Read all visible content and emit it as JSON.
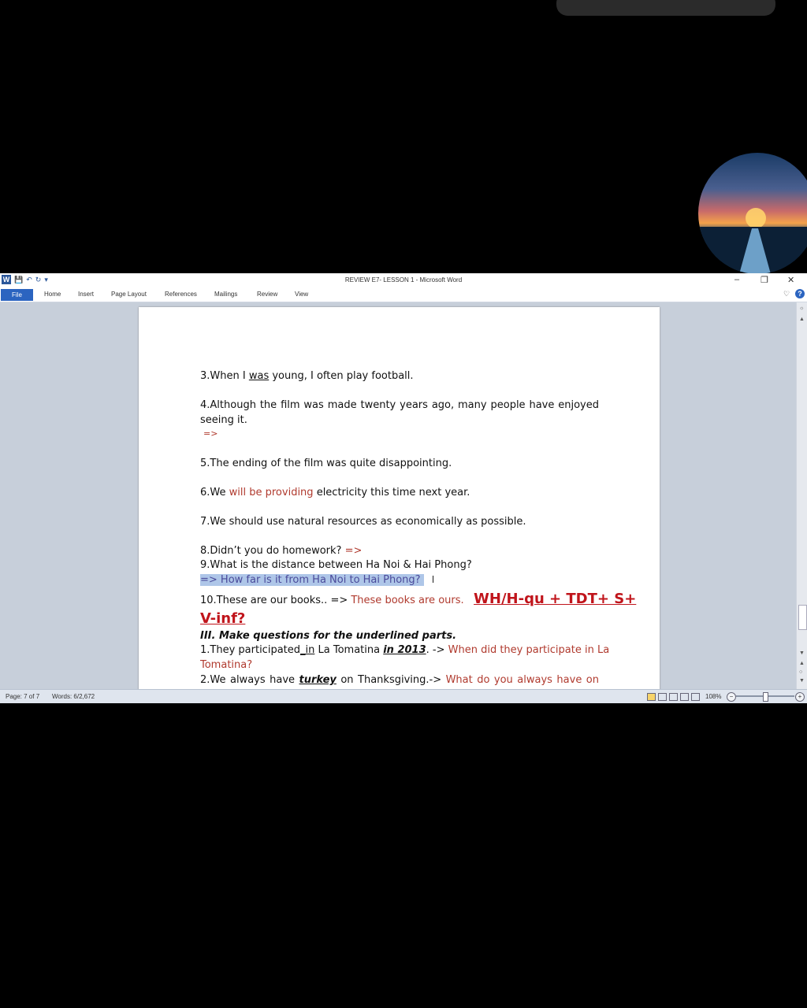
{
  "window": {
    "title": "REVIEW E7- LESSON 1  -  Microsoft Word",
    "app_icon": "W"
  },
  "ribbon": {
    "file": "File",
    "tabs": [
      "Home",
      "Insert",
      "Page Layout",
      "References",
      "Mailings",
      "Review",
      "View"
    ]
  },
  "document": {
    "l3_pre": "3.When I ",
    "l3_u": "was",
    "l3_post": " young, I often play football.",
    "l4a": "4.Although the film was made twenty years ago, many people have enjoyed",
    "l4b": "seeing it.",
    "l4c": "=>",
    "l5": "5.The ending of the film was quite disappointing.",
    "l6_pre": "6.We ",
    "l6_red": "will be providing",
    "l6_post": " electricity this time next year.",
    "l7": "7.We should use natural resources as economically as possible.",
    "l8_pre": "8.Didn’t you do homework? ",
    "l8_red": "=>",
    "l9": "9.What is the distance between Ha Noi & Hai Phong?",
    "l9_ans": "=> How far  is it from Ha Noi to Hai Phong? ",
    "l10_pre": "10.These are our books.. => ",
    "l10_red": "These books  are ours.",
    "formula_a": "WH/H-qu + TDT+ S+",
    "formula_b": "V-inf?",
    "section": "III. Make questions for the underlined parts.",
    "q1_pre": "1.They participated",
    "q1_u": "_in",
    "q1_mid": " La Tomatina ",
    "q1_bold": "in 2013",
    "q1_post": ". -> ",
    "q1_red": "When did they participate in La",
    "q1_red2": "Tomatina?",
    "q2_pre": "2.We always have ",
    "q2_bold": "turkey",
    "q2_post": " on Thanksgiving.->  ",
    "q2_red": "What do you always have on"
  },
  "status": {
    "page": "Page: 7 of 7",
    "words": "Words: 6/2,672",
    "zoom": "108%"
  }
}
